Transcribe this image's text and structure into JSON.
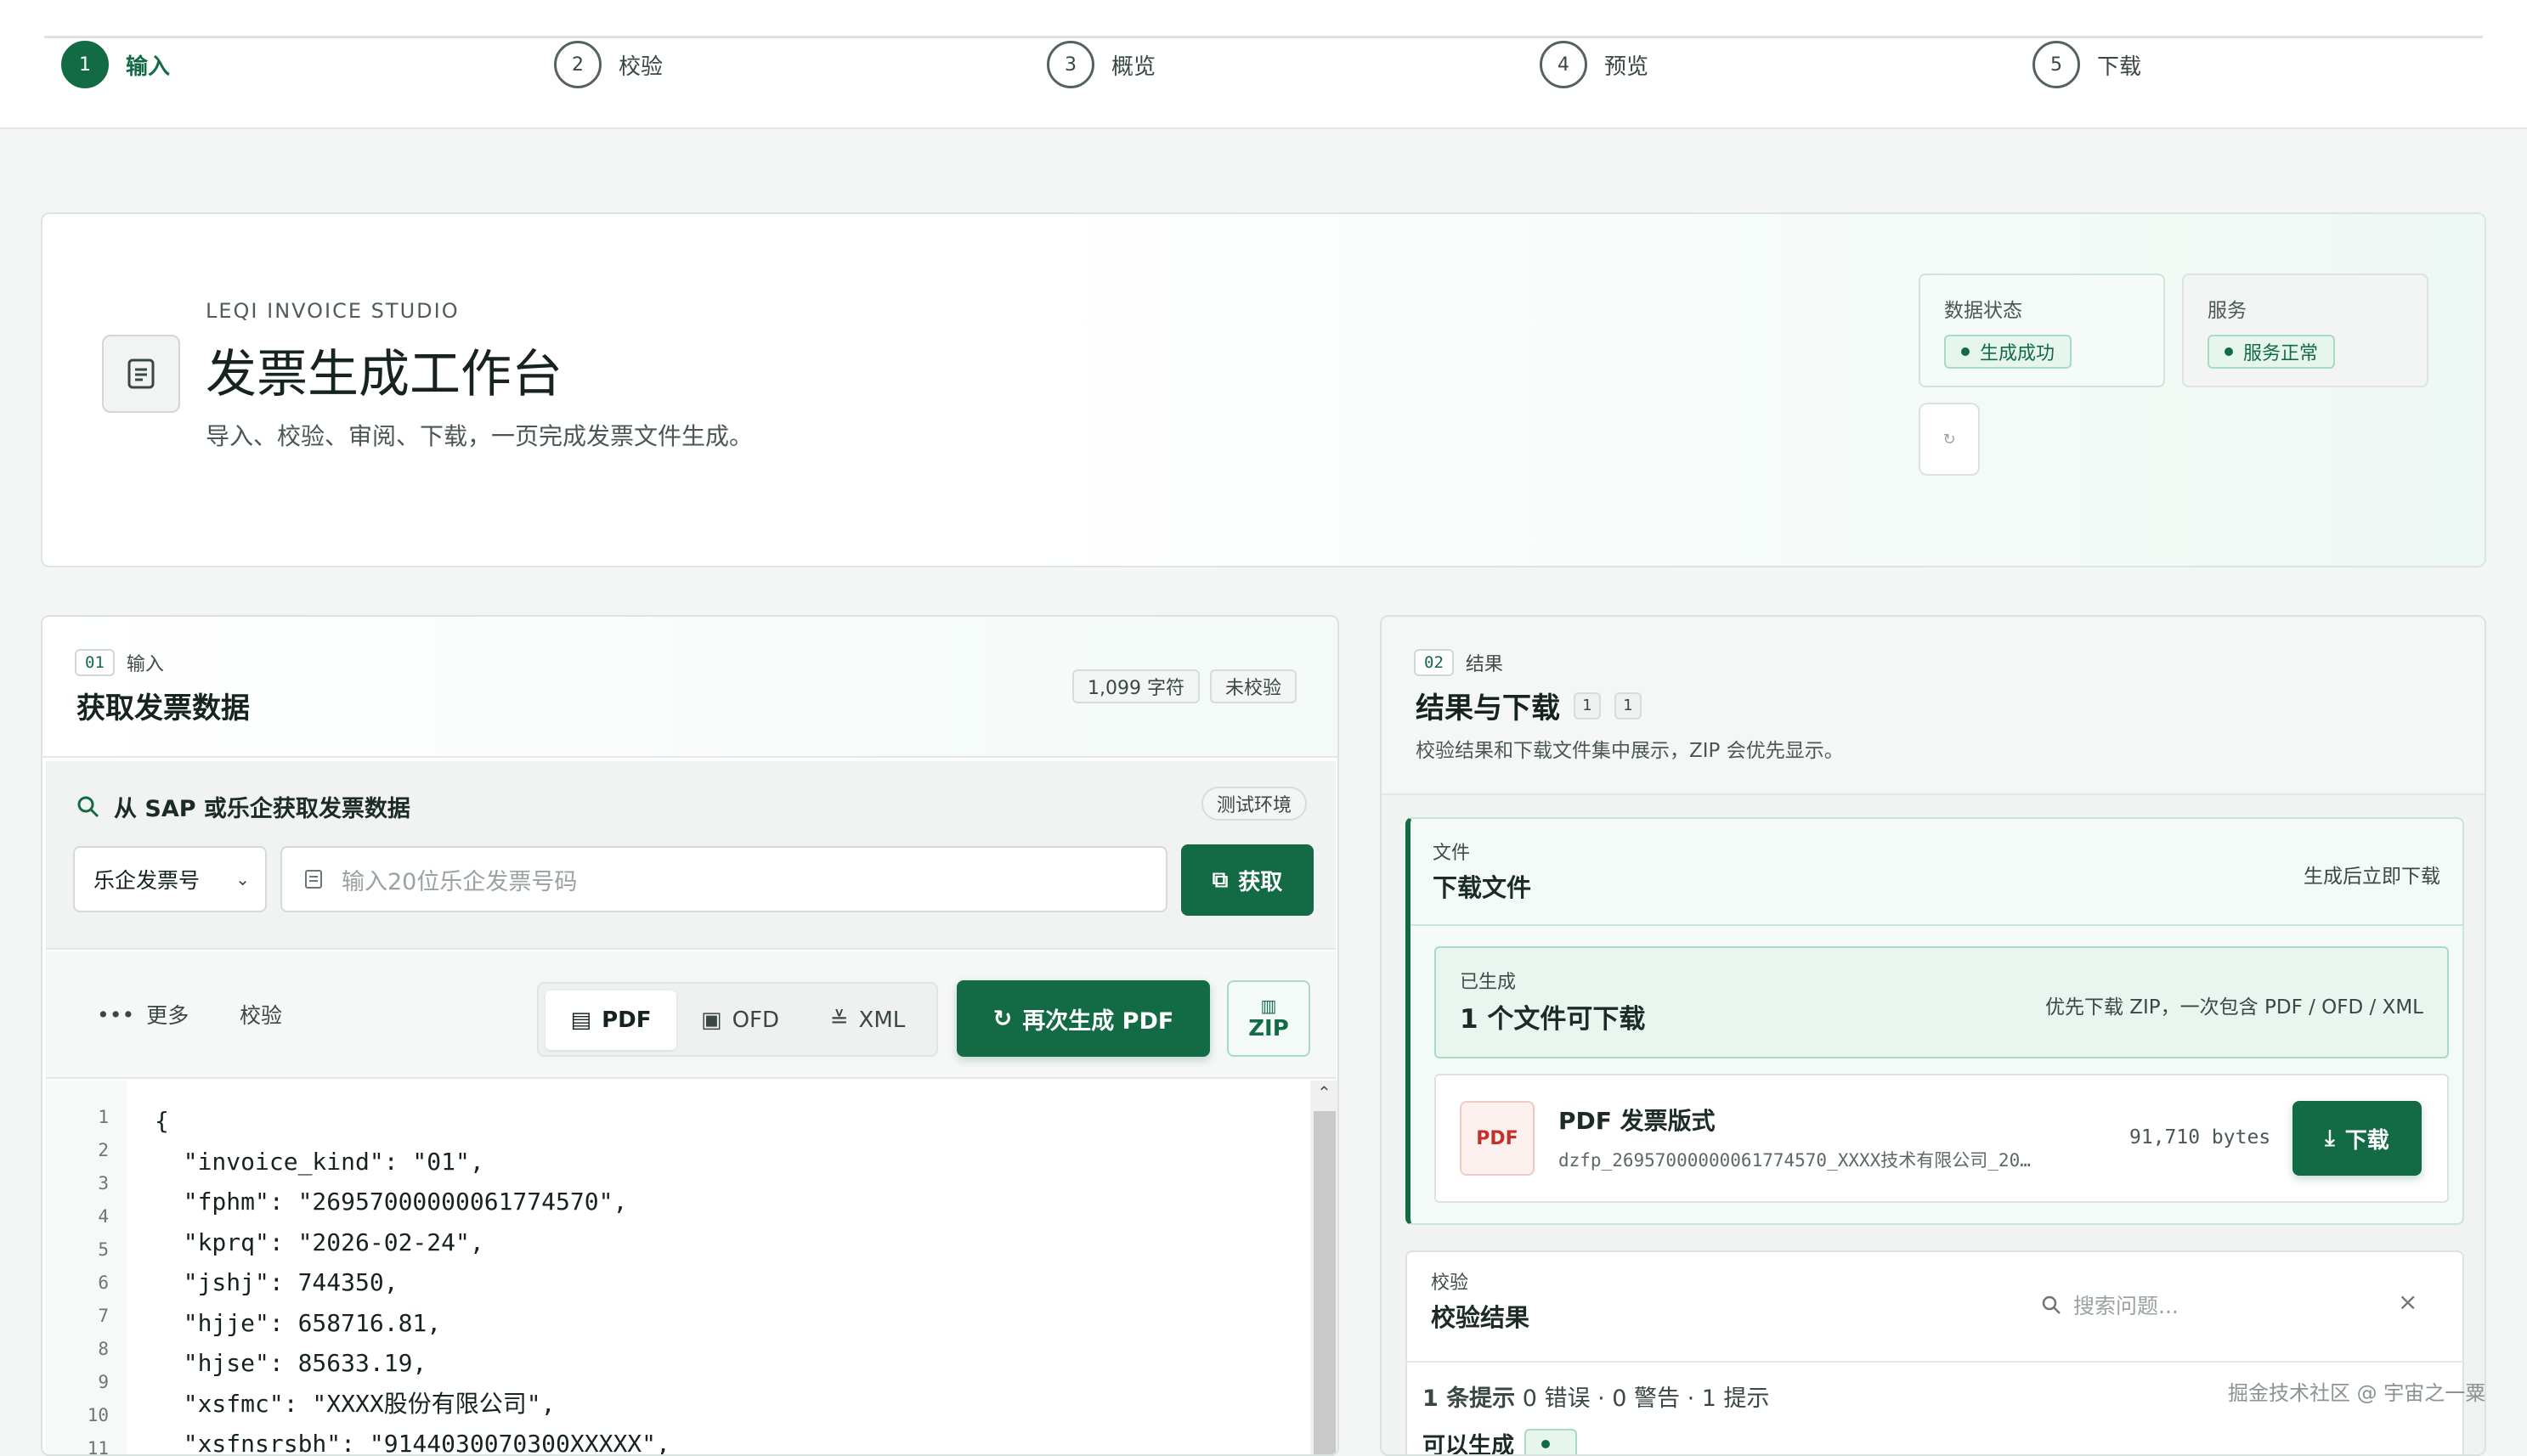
{
  "steps": [
    {
      "num": "1",
      "label": "输入"
    },
    {
      "num": "2",
      "label": "校验"
    },
    {
      "num": "3",
      "label": "概览"
    },
    {
      "num": "4",
      "label": "预览"
    },
    {
      "num": "5",
      "label": "下载"
    }
  ],
  "hero": {
    "brand": "LEQI INVOICE STUDIO",
    "title": "发票生成工作台",
    "subtitle": "导入、校验、审阅、下载，一页完成发票文件生成。",
    "icon": "document-icon",
    "data_status_label": "数据状态",
    "data_status_value": "生成成功",
    "service_label": "服务",
    "service_value": "服务正常"
  },
  "input_panel": {
    "tag": "01",
    "section": "输入",
    "title": "获取发票数据",
    "char_count": "1,099 字符",
    "validation_state": "未校验",
    "sap": {
      "heading": "从 SAP 或乐企获取发票数据",
      "env_badge": "测试环境",
      "select_value": "乐企发票号",
      "input_placeholder": "输入20位乐企发票号码",
      "fetch_label": "获取"
    },
    "toolbar": {
      "more_label": "更多",
      "validate_label": "校验",
      "formats": [
        "PDF",
        "OFD",
        "XML"
      ],
      "active_format": "PDF",
      "regenerate_label": "再次生成 PDF",
      "zip_label": "ZIP"
    },
    "editor": {
      "line_numbers": [
        "1",
        "2",
        "3",
        "4",
        "5",
        "6",
        "7",
        "8",
        "9",
        "10",
        "11"
      ],
      "code": "{\n  \"invoice_kind\": \"01\",\n  \"fphm\": \"26957000000061774570\",\n  \"kprq\": \"2026-02-24\",\n  \"jshj\": 744350,\n  \"hjje\": 658716.81,\n  \"hjse\": 85633.19,\n  \"xsfmc\": \"XXXX股份有限公司\",\n  \"xsfnsrsbh\": \"9144030070300XXXXX\","
    }
  },
  "result_panel": {
    "tag": "02",
    "section": "结果",
    "title": "结果与下载",
    "count_a": "1",
    "count_b": "1",
    "description": "校验结果和下载文件集中展示，ZIP 会优先显示。",
    "files": {
      "section": "文件",
      "title": "下载文件",
      "hint": "生成后立即下载",
      "generated_label": "已生成",
      "generated_title": "1 个文件可下载",
      "generated_hint": "优先下载 ZIP，一次包含 PDF / OFD / XML",
      "file": {
        "badge": "PDF",
        "name": "PDF 发票版式",
        "filename": "dzfp_26957000000061774570_XXXX技术有限公司_20…",
        "size": "91,710 bytes",
        "download_label": "下载"
      }
    },
    "validation": {
      "section": "校验",
      "title": "校验结果",
      "search_placeholder": "搜索问题...",
      "summary_strong": "1 条提示",
      "summary_rest": " 0 错误 · 0 警告 · 1 提示",
      "next_label": "可以生成"
    }
  },
  "watermark": "掘金技术社区 @ 宇宙之一粟",
  "colors": {
    "accent": "#136b46",
    "pdf": "#c4302b"
  }
}
